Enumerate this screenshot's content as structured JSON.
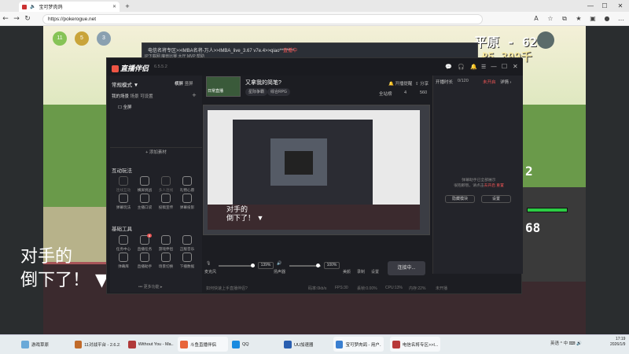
{
  "browser": {
    "tab_title": "宝可梦肉鸽",
    "new_tab": "+",
    "url": "https://pokerogue.net",
    "win_min": "—",
    "win_max": "☐",
    "win_close": "✕"
  },
  "game": {
    "hud_location": "平原 - 62",
    "hud_money": "₽5,309千",
    "hp_level": "2",
    "hp_value": "68",
    "dialog_line1": "对手的",
    "dialog_line2": "倒下了！ ▼"
  },
  "room_window": {
    "title": "电信名将专区>>IMBA名将-万人>>IMBA_live_3.67 v7e.4>>qiao********",
    "status": "直播中",
    "tabs": "IP下载网  魔兽比赛  大厅  MVP  帮助"
  },
  "app": {
    "brand": "直播伴侣",
    "version": "6.5.5.2",
    "mode": "常规模式 ▼",
    "mode_right_a": "横屏",
    "mode_right_b": "竖屏",
    "scene_label": "我的场景",
    "scene_a": "场景",
    "scene_b": "可设置",
    "scene_item": "全屏",
    "add_source": "+ 添加素材",
    "interact_title": "互动玩法",
    "interact_items": [
      "连线互动",
      "横屏挑战",
      "多人连线",
      "礼物心愿",
      "弹幕玩法",
      "主播口袋",
      "投稿宣传",
      "弹幕投影"
    ],
    "tools_title": "基础工具",
    "tools_items": [
      "任务中心",
      "直播任务",
      "游戏伴侣",
      "正版音乐",
      "弹幕库",
      "直播助手",
      "场景切换",
      "下播数据"
    ],
    "tools_badge": "8",
    "more_fn": "••• 更多功能 ▸",
    "stream_title": "又拿我的简笔?",
    "stream_sub": "日常直播",
    "tag1": "星际争霸",
    "tag2": "综合RPG",
    "right_notice": "开播提醒",
    "right_share": "分享",
    "right_fans": "全站榜",
    "right_num1": "4",
    "right_num2": "560",
    "chat_title": "开播时长",
    "chat_count": "0/120",
    "chat_status": "未开启",
    "chat_detail": "详情 ›",
    "chat_msg_1": "弹幕助手已全部展示",
    "chat_msg_2": "很抱歉哦，请点击",
    "chat_msg_link": "去开启",
    "chat_msg_3": "重置",
    "chat_btn1": "隐藏模块",
    "chat_btn2": "设置",
    "mic_label": "麦克风",
    "mic_pct": "139%",
    "speaker_label": "扬声器",
    "speaker_pct": "100%",
    "ctrl_beauty": "美颜",
    "ctrl_record": "录制",
    "ctrl_settings": "设置",
    "live_button": "连接中...",
    "status_left": "如何快速上手直播伴侣?",
    "status_bitrate": "码率:0kb/s",
    "status_fps": "FPS:30",
    "status_drop": "丢帧:0.00%",
    "status_cpu": "CPU:13%",
    "status_mem": "内存:22%",
    "status_ver": "未开播"
  },
  "nested": {
    "text1": "对手的",
    "text2": "倒下了！ ▼"
  },
  "taskbar": {
    "items": [
      "游戏草原",
      "11对战平台 - 2.6.2...",
      "Without You - Ma...",
      "斗鱼直播伴侣",
      "QQ",
      "UU加速器",
      "宝可梦肉鸽 - 用户...",
      "电信名将专区>>I..."
    ],
    "tray": "英语 ^ 中 ⌨ 🔊",
    "time": "17:19",
    "date": "2026/1/9",
    "lang": "英语\nUS"
  },
  "colors": {
    "accent": "#e55353",
    "app_bg": "#1c1d22",
    "game_dialog": "#3b2a2e"
  }
}
